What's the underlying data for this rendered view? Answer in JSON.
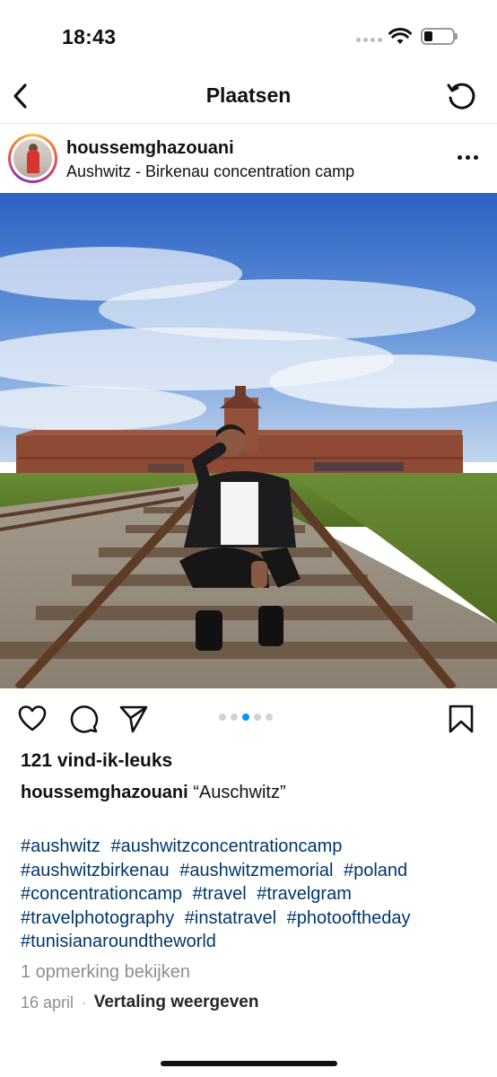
{
  "status_bar": {
    "time": "18:43"
  },
  "nav": {
    "title": "Plaatsen"
  },
  "post": {
    "username": "houssemghazouani",
    "location": "Aushwitz - Birkenau concentration camp",
    "likes": "121 vind-ik-leuks",
    "caption_user": "houssemghazouani",
    "caption_text": "“Auschwitz”",
    "hashtags": [
      "#aushwitz",
      "#aushwitzconcentrationcamp",
      "#aushwitzbirkenau",
      "#aushwitzmemorial",
      "#poland",
      "#concentrationcamp",
      "#travel",
      "#travelgram",
      "#travelphotography",
      "#instatravel",
      "#photooftheday",
      "#tunisianaroundtheworld"
    ],
    "view_comments": "1 opmerking bekijken",
    "date": "16 april",
    "separator": "·",
    "translate": "Vertaling weergeven"
  },
  "carousel": {
    "count": 5,
    "active": 3
  },
  "colors": {
    "link": "#00376b",
    "accent": "#0095f6",
    "muted": "#8e8e8e"
  },
  "icons": [
    "back-icon",
    "refresh-icon",
    "more-icon",
    "heart-icon",
    "comment-icon",
    "share-icon",
    "bookmark-icon"
  ]
}
